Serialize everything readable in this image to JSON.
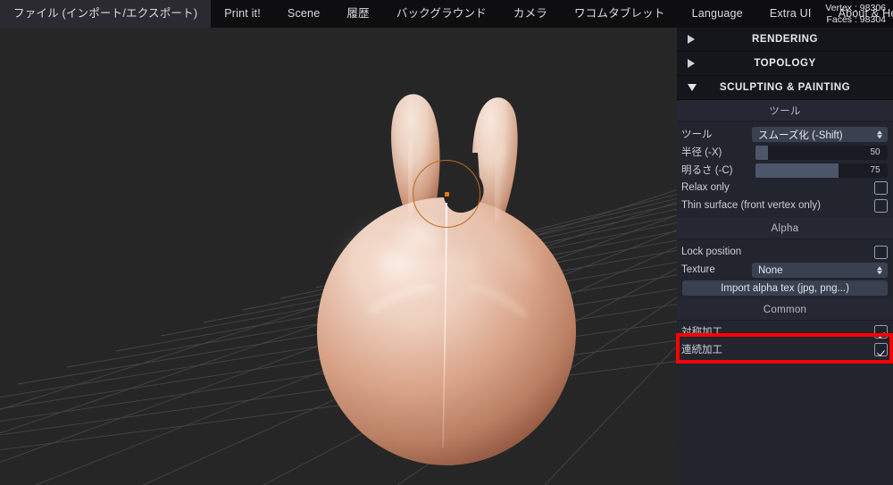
{
  "menubar": {
    "items": [
      {
        "label": "ファイル (インポート/エクスポート)",
        "name": "menu-file"
      },
      {
        "label": "Print it!",
        "name": "menu-print-it"
      },
      {
        "label": "Scene",
        "name": "menu-scene"
      },
      {
        "label": "履歴",
        "name": "menu-history"
      },
      {
        "label": "バックグラウンド",
        "name": "menu-background"
      },
      {
        "label": "カメラ",
        "name": "menu-camera"
      },
      {
        "label": "ワコムタブレット",
        "name": "menu-wacom-tablet"
      },
      {
        "label": "Language",
        "name": "menu-language"
      },
      {
        "label": "Extra UI",
        "name": "menu-extra-ui"
      },
      {
        "label": "About & Help",
        "name": "menu-about-help"
      }
    ],
    "vertex_count": "Vertex : 98306",
    "faces_count": "Faces : 98304"
  },
  "viewport": {
    "brush_cursor_color": "#c2691f",
    "brush_center_dot_color": "#e07a18",
    "symmetry_line_color": "#f5ece6",
    "background_color": "#262626",
    "model_description": "skin-toned sculpted head with two ears"
  },
  "panel": {
    "sections": [
      {
        "title": "RENDERING",
        "expanded": false,
        "icon": "triangle-right-icon"
      },
      {
        "title": "TOPOLOGY",
        "expanded": false,
        "icon": "triangle-right-icon"
      },
      {
        "title": "SCULPTING & PAINTING",
        "expanded": true,
        "icon": "triangle-down-icon"
      }
    ],
    "tool_group": {
      "header": "ツール",
      "tool_label": "ツール",
      "tool_value": "スムーズ化 (-Shift)",
      "radius_label": "半径 (-X)",
      "radius_value": "50",
      "radius_fill_percent": 11,
      "intensity_label": "明るさ (-C)",
      "intensity_value": "75",
      "intensity_fill_percent": 75,
      "relax_only_label": "Relax only",
      "relax_only_checked": false,
      "thin_surface_label": "Thin surface (front vertex only)",
      "thin_surface_checked": false
    },
    "alpha_group": {
      "header": "Alpha",
      "lock_position_label": "Lock position",
      "lock_position_checked": false,
      "texture_label": "Texture",
      "texture_value": "None",
      "import_button_label": "Import alpha tex (jpg, png...)"
    },
    "common_group": {
      "header": "Common",
      "symmetry_label": "対称加工",
      "symmetry_checked": true,
      "continuous_label": "連続加工",
      "continuous_checked": true
    }
  },
  "annotation": {
    "highlight_color": "#fe0000",
    "highlight_target": "対称加工"
  }
}
